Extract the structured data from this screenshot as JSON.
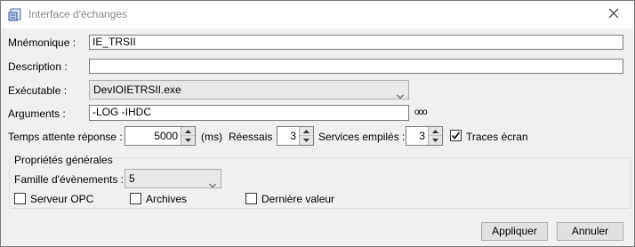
{
  "window": {
    "title": "Interface d'échanges"
  },
  "form": {
    "mnemonique": {
      "label": "Mnémonique :",
      "value": "IE_TRSII"
    },
    "description": {
      "label": "Description :",
      "value": ""
    },
    "executable": {
      "label": "Exécutable :",
      "value": "DevIOIETRSII.exe"
    },
    "arguments": {
      "label": "Arguments :",
      "value": "-LOG -IHDC",
      "browse_label": "ooo"
    },
    "timeout": {
      "label": "Temps attente réponse :",
      "value": "5000",
      "unit": "(ms)"
    },
    "retries": {
      "label": "Réessais :",
      "value": "3"
    },
    "stacked_services": {
      "label": "Services empilés :",
      "value": "3"
    },
    "screen_traces": {
      "label": "Traces écran",
      "checked": true
    }
  },
  "general": {
    "title": "Propriétés générales",
    "event_family": {
      "label": "Famille d'évènements :",
      "value": "5"
    },
    "opc_server": {
      "label": "Serveur OPC",
      "checked": false
    },
    "archives": {
      "label": "Archives",
      "checked": false
    },
    "last_value": {
      "label": "Dernière valeur",
      "checked": false
    }
  },
  "buttons": {
    "apply": "Appliquer",
    "cancel": "Annuler"
  }
}
